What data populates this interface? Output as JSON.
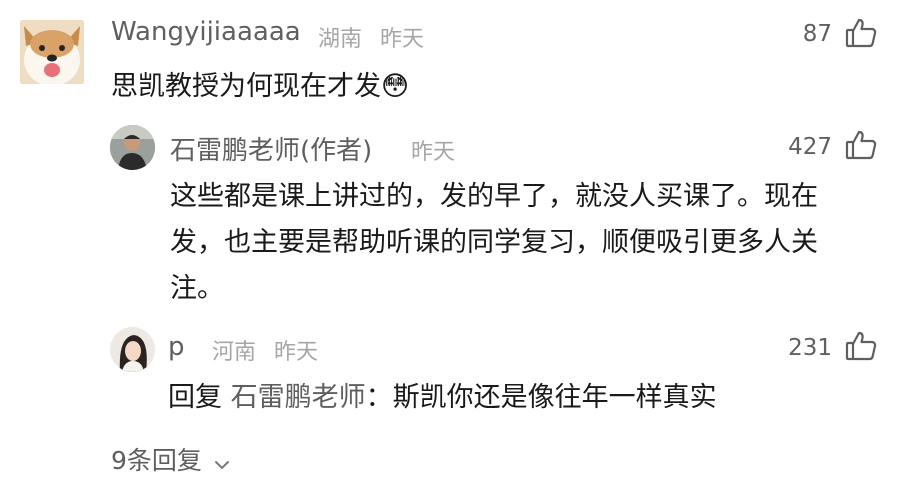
{
  "comments": [
    {
      "author": "Wangyijiaaaaa",
      "location": "湖南",
      "time": "昨天",
      "likes": "87",
      "text": "思凯教授为何现在才发",
      "emoji": "😳"
    },
    {
      "author": "石雷鹏老师(作者)",
      "time": "昨天",
      "likes": "427",
      "text": "这些都是课上讲过的，发的早了，就没人买课了。现在发，也主要是帮助听课的同学复习，顺便吸引更多人关注。"
    },
    {
      "author": "p",
      "location": "河南",
      "time": "昨天",
      "likes": "231",
      "reply_prefix": "回复 ",
      "reply_target": "石雷鹏老师",
      "reply_sep": "：",
      "text": "斯凯你还是像往年一样真实"
    }
  ],
  "more_replies": "9条回复",
  "icons": {
    "like": "thumbs-up-icon",
    "expand": "chevron-down-icon",
    "emoji": "flushed-face-emoji"
  }
}
